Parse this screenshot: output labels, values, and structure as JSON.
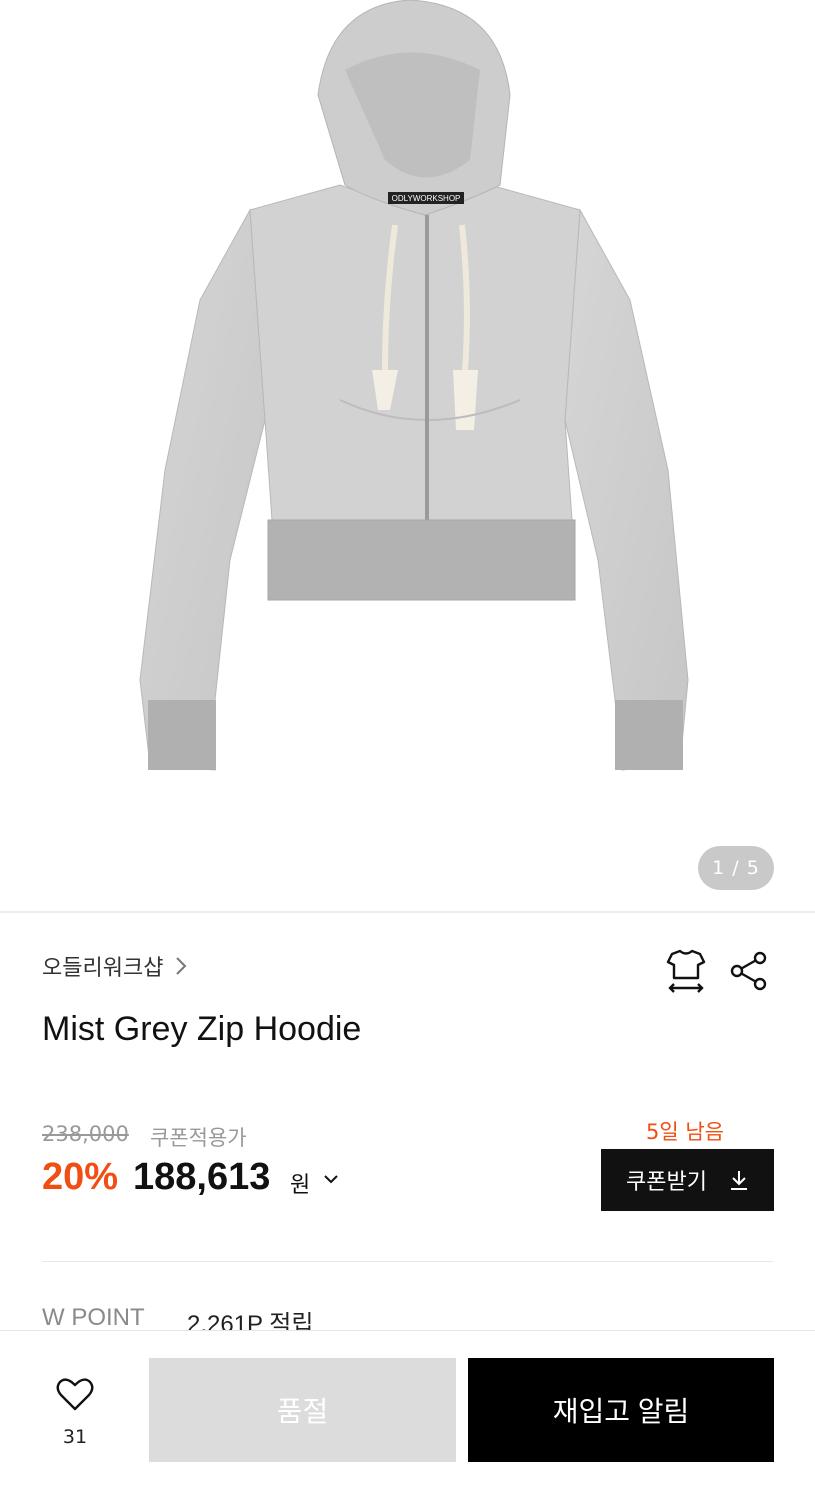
{
  "gallery": {
    "image_alt": "Mist Grey Zip Hoodie",
    "label_text": "ODLYWORKSHOP",
    "indicator": "1 / 5"
  },
  "product": {
    "brand": "오들리워크샵",
    "title": "Mist Grey Zip Hoodie",
    "original_price": "238,000",
    "coupon_label": "쿠폰적용가",
    "discount": "20%",
    "price": "188,613",
    "currency": "원"
  },
  "coupon": {
    "days_left": "5일 남음",
    "button_label": "쿠폰받기"
  },
  "points": {
    "label": "W POINT",
    "value": "2,261P 적립"
  },
  "bottom_bar": {
    "like_count": "31",
    "soldout_label": "품절",
    "restock_label": "재입고 알림"
  },
  "colors": {
    "accent": "#f04e12",
    "primary_button": "#000000",
    "disabled_button": "#dcdcdc"
  },
  "icons": {
    "size": "size-guide-icon",
    "share": "share-icon",
    "like": "heart-icon",
    "download": "download-icon"
  }
}
